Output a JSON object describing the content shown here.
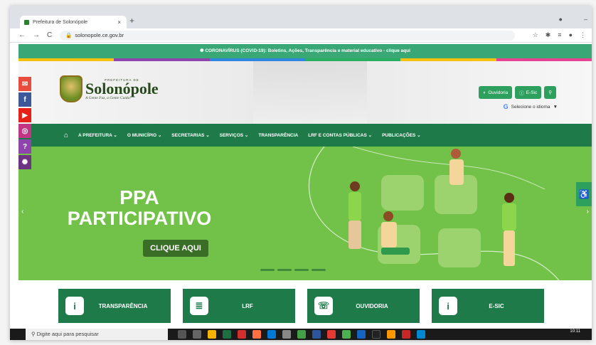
{
  "browser": {
    "tab_title": "Prefeitura de Solonópole",
    "url": "solonopole.ce.gov.br"
  },
  "covid_bar": {
    "text": "✺ CORONAVÍRUS (COVID-19): Boletins, Ações, Transparência e material educativo - clique aqui"
  },
  "header": {
    "prefeitura_label": "PREFEITURA DE",
    "city_name": "Solonópole",
    "slogan": "A Gente Faz, a Gente Cuida!",
    "ouvidoria_button": "Ouvidoria",
    "esic_button": "E-Sic",
    "language_selector": "Selecione o idioma"
  },
  "nav": {
    "items": [
      "A PREFEITURA ⌄",
      "O MUNICÍPIO ⌄",
      "SECRETARIAS ⌄",
      "SERVIÇOS ⌄",
      "TRANSPARÊNCIA",
      "LRF E CONTAS PÚBLICAS ⌄",
      "PUBLICAÇÕES ⌄"
    ]
  },
  "banner": {
    "line1": "PPA",
    "line2": "PARTICIPATIVO",
    "cta": "CLIQUE AQUI"
  },
  "cards": [
    {
      "label": "TRANSPARÊNCIA",
      "icon": "info-icon"
    },
    {
      "label": "LRF",
      "icon": "document-icon"
    },
    {
      "label": "OUVIDORIA",
      "icon": "phone-icon"
    },
    {
      "label": "E-SIC",
      "icon": "info-icon"
    }
  ],
  "taskbar": {
    "search_placeholder": "Digite aqui para pesquisar",
    "time": "10:11"
  },
  "colors": {
    "primary_green": "#1f7a4a",
    "banner_green": "#72c24a",
    "covid_green": "#3aa876"
  }
}
